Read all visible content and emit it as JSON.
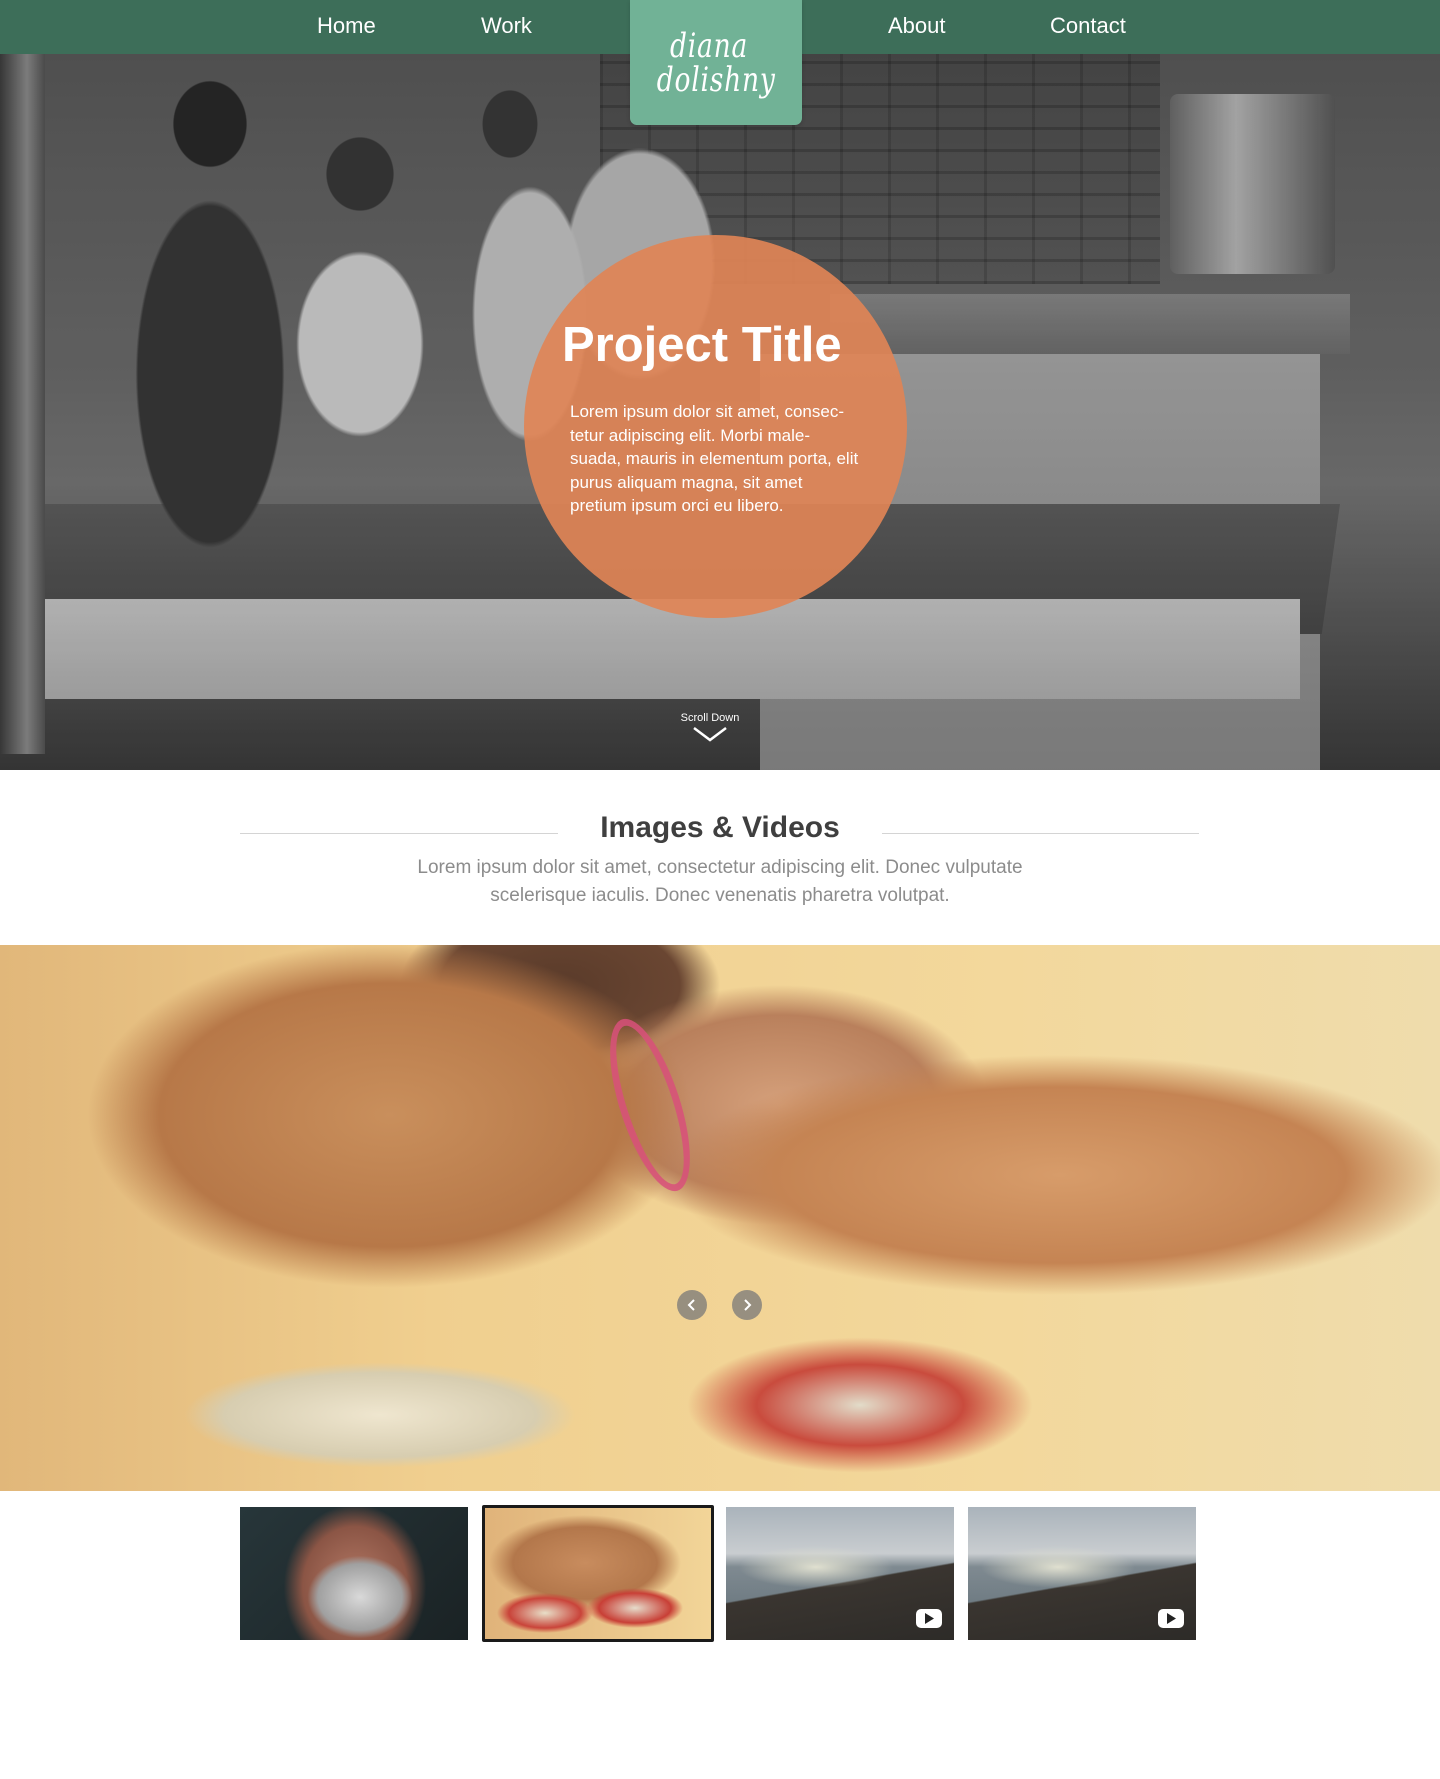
{
  "nav": {
    "items": [
      "Home",
      "Work",
      "About",
      "Contact"
    ],
    "logo_line1": "diana",
    "logo_line2": "dolishny"
  },
  "hero": {
    "title": "Project Title",
    "body": "Lorem ipsum dolor sit amet, consec-tetur adipiscing elit. Morbi male-suada, mauris in elementum porta, elit purus aliquam magna, sit amet pretium ipsum orci eu libero.",
    "scroll_label": "Scroll Down"
  },
  "section": {
    "title": "Images & Videos",
    "subtitle": "Lorem ipsum dolor sit amet, consectetur adipiscing elit. Donec vulputate scelerisque iaculis. Donec venenatis pharetra volutpat."
  },
  "gallery": {
    "thumbnails": [
      {
        "type": "image",
        "selected": false
      },
      {
        "type": "image",
        "selected": true
      },
      {
        "type": "video",
        "selected": false,
        "icon": "play-icon"
      },
      {
        "type": "video",
        "selected": false,
        "icon": "play-icon"
      }
    ],
    "prev_icon": "chevron-left-icon",
    "next_icon": "chevron-right-icon"
  },
  "colors": {
    "nav_bg": "#3d6e59",
    "logo_bg": "#71b296",
    "accent_circle": "#e08456",
    "heading_text": "#3f3f3f",
    "muted_text": "#8c8c8c"
  }
}
